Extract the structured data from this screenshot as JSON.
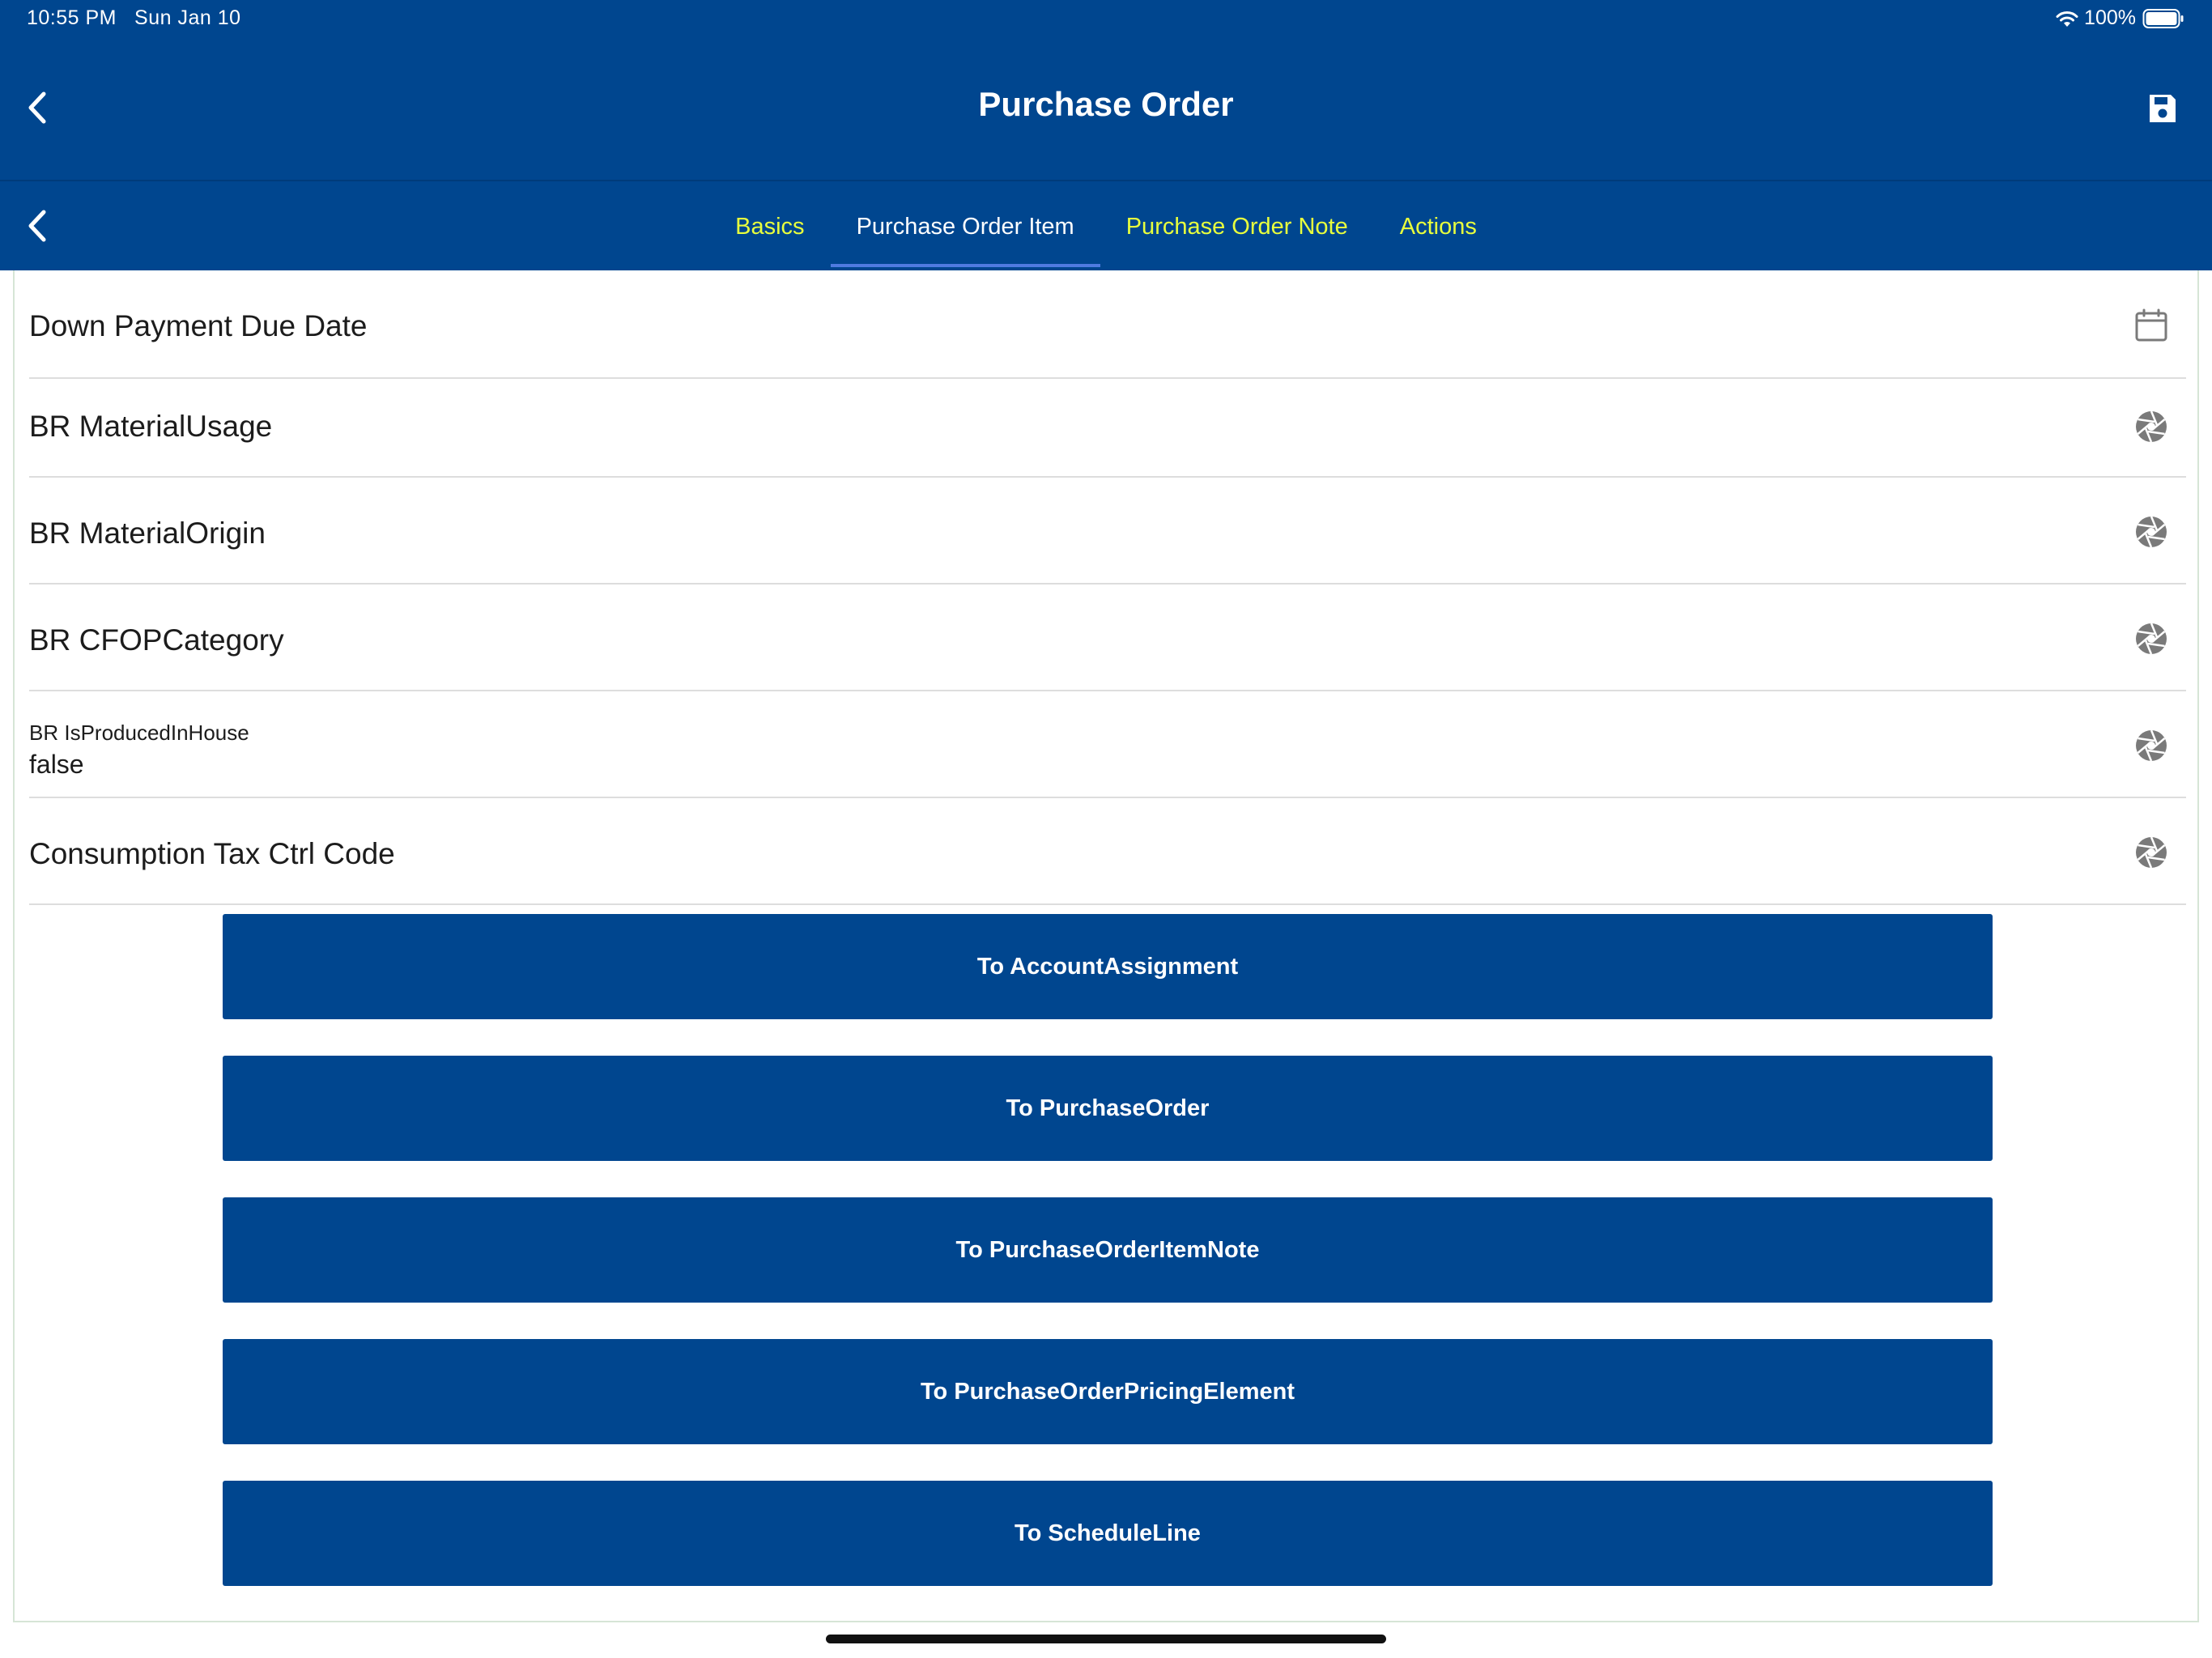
{
  "status_bar": {
    "time": "10:55 PM",
    "date": "Sun Jan 10",
    "battery": "100%"
  },
  "header": {
    "title": "Purchase Order"
  },
  "tabs": [
    {
      "label": "Basics",
      "active": false
    },
    {
      "label": "Purchase Order Item",
      "active": true
    },
    {
      "label": "Purchase Order Note",
      "active": false
    },
    {
      "label": "Actions",
      "active": false
    }
  ],
  "fields": [
    {
      "label": "Down Payment Due Date",
      "icon": "calendar-icon"
    },
    {
      "label": "BR MaterialUsage",
      "icon": "aperture-icon"
    },
    {
      "label": "BR MaterialOrigin",
      "icon": "aperture-icon"
    },
    {
      "label": "BR CFOPCategory",
      "icon": "aperture-icon"
    },
    {
      "label": "BR IsProducedInHouse",
      "value": "false",
      "icon": "aperture-icon"
    },
    {
      "label": "Consumption Tax Ctrl Code",
      "icon": "aperture-icon"
    }
  ],
  "nav_buttons": [
    "To AccountAssignment",
    "To PurchaseOrder",
    "To PurchaseOrderItemNote",
    "To PurchaseOrderPricingElement",
    "To ScheduleLine"
  ],
  "colors": {
    "primary": "#00468f",
    "tab_inactive": "#e8ff3d",
    "tab_indicator": "#4f7be0"
  }
}
